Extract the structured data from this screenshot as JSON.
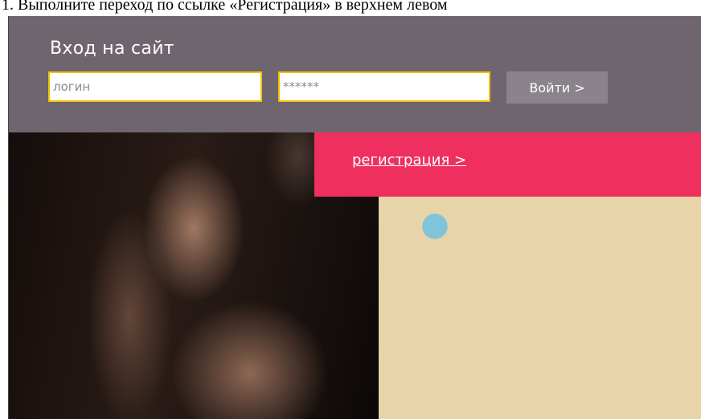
{
  "document": {
    "instruction_text": "1.   Выполните переход по ссылке «Регистрация» в верхнем левом"
  },
  "login": {
    "title": "Вход на сайт",
    "login_placeholder": "логин",
    "password_placeholder": "******",
    "submit_label": "Войти >"
  },
  "banner": {
    "register_link": "регистрация >"
  },
  "colors": {
    "header_bg": "#6e656f",
    "field_border": "#f5c200",
    "button_bg": "#8b838c",
    "banner_bg": "#ef2f5e"
  }
}
